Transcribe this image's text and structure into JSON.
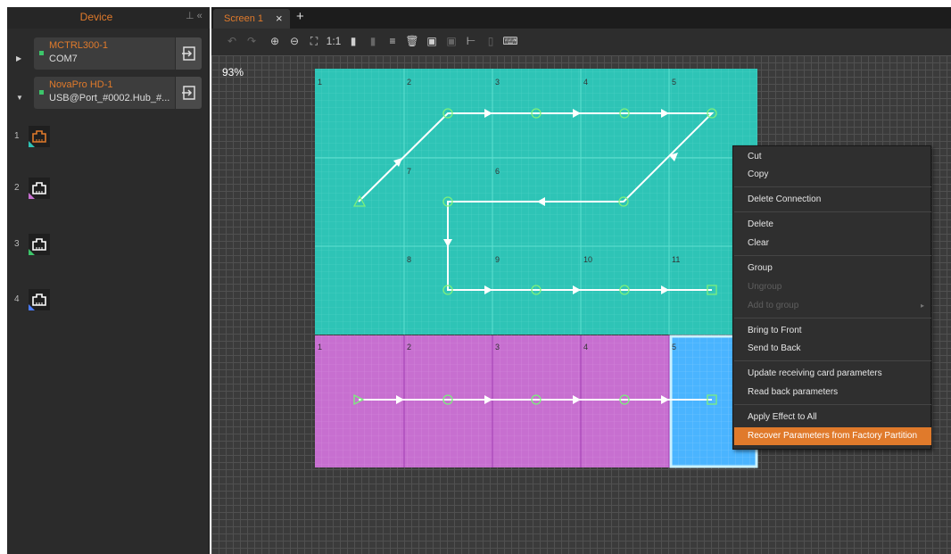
{
  "sidebar": {
    "title": "Device",
    "devices": [
      {
        "name": "MCTRL300-1",
        "sub": "COM7"
      },
      {
        "name": "NovaPro HD-1",
        "sub": "USB@Port_#0002.Hub_#..."
      }
    ],
    "ports": [
      "1",
      "2",
      "3",
      "4"
    ]
  },
  "tabs": [
    {
      "label": "Screen 1"
    }
  ],
  "canvas": {
    "zoom": "93%",
    "teal_cells": [
      "1",
      "2",
      "3",
      "4",
      "5",
      "7",
      "6",
      "8",
      "9",
      "10",
      "11"
    ],
    "purple_cells": [
      "1",
      "2",
      "3",
      "4",
      "5"
    ]
  },
  "context_menu": {
    "items": [
      "Cut",
      "Copy",
      "Delete Connection",
      "Delete",
      "Clear",
      "Group",
      "Ungroup",
      "Add to group",
      "Bring to Front",
      "Send to Back",
      "Update receiving card parameters",
      "Read back parameters",
      "Apply Effect to All",
      "Recover Parameters from Factory Partition"
    ]
  },
  "colors": {
    "accent": "#e07a2b",
    "teal": "#2ec4b6",
    "purple": "#c76fd0",
    "blue": "#4ab4ff"
  }
}
